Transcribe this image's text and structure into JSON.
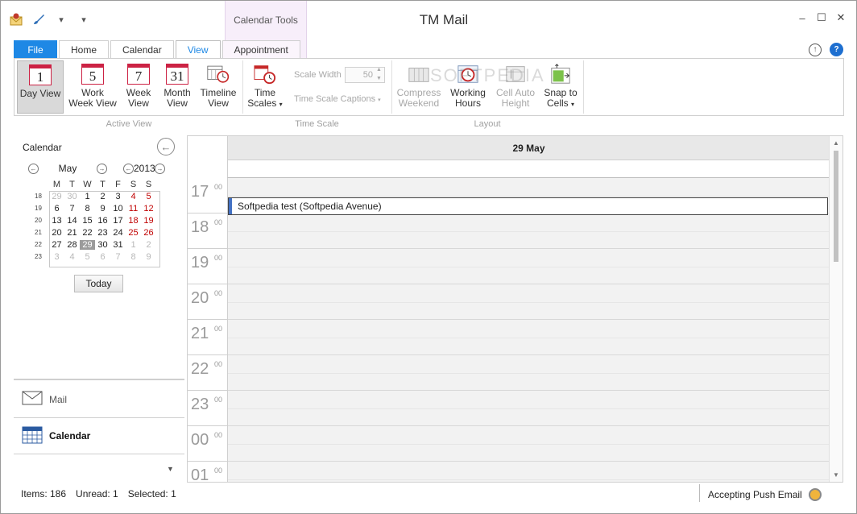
{
  "app": {
    "title": "TM Mail",
    "contextual_group": "Calendar Tools"
  },
  "ribbon": {
    "tabs": [
      {
        "label": "File",
        "state": "file"
      },
      {
        "label": "Home",
        "state": ""
      },
      {
        "label": "Calendar",
        "state": ""
      },
      {
        "label": "View",
        "state": "active"
      },
      {
        "label": "Appointment",
        "state": "contextual"
      }
    ],
    "active_view": {
      "group_label": "Active View",
      "day": {
        "num": "1",
        "label": "Day View"
      },
      "work_week": {
        "num": "5",
        "label1": "Work",
        "label2": "Week View"
      },
      "week": {
        "num": "7",
        "label1": "Week",
        "label2": "View"
      },
      "month": {
        "num": "31",
        "label1": "Month",
        "label2": "View"
      },
      "timeline": {
        "label1": "Timeline",
        "label2": "View"
      }
    },
    "time_scale": {
      "group_label": "Time Scale",
      "time_scales": {
        "label1": "Time",
        "label2": "Scales"
      },
      "scale_width_label": "Scale Width",
      "scale_width_value": "50",
      "captions_label": "Time Scale Captions"
    },
    "layout": {
      "group_label": "Layout",
      "compress": {
        "label1": "Compress",
        "label2": "Weekend"
      },
      "working": {
        "label1": "Working",
        "label2": "Hours"
      },
      "cell_auto": {
        "label1": "Cell Auto",
        "label2": "Height"
      },
      "snap": {
        "label1": "Snap to",
        "label2": "Cells"
      }
    },
    "watermark": "SOFTPEDIA"
  },
  "navigator": {
    "title": "Calendar",
    "month": "May",
    "year": "2013",
    "weekday_headers": [
      "M",
      "T",
      "W",
      "T",
      "F",
      "S",
      "S"
    ],
    "weeks": [
      {
        "num": "18",
        "days": [
          "29",
          "30",
          "1",
          "2",
          "3",
          "4",
          "5"
        ]
      },
      {
        "num": "19",
        "days": [
          "6",
          "7",
          "8",
          "9",
          "10",
          "11",
          "12"
        ]
      },
      {
        "num": "20",
        "days": [
          "13",
          "14",
          "15",
          "16",
          "17",
          "18",
          "19"
        ]
      },
      {
        "num": "21",
        "days": [
          "20",
          "21",
          "22",
          "23",
          "24",
          "25",
          "26"
        ]
      },
      {
        "num": "22",
        "days": [
          "27",
          "28",
          "29",
          "30",
          "31",
          "1",
          "2"
        ]
      },
      {
        "num": "23",
        "days": [
          "3",
          "4",
          "5",
          "6",
          "7",
          "8",
          "9"
        ]
      }
    ],
    "today_button": "Today"
  },
  "nav_pane": {
    "mail": "Mail",
    "calendar": "Calendar"
  },
  "day_view": {
    "date_header": "29 May",
    "hours": [
      {
        "h": "17",
        "m": "00"
      },
      {
        "h": "18",
        "m": "00"
      },
      {
        "h": "19",
        "m": "00"
      },
      {
        "h": "20",
        "m": "00"
      },
      {
        "h": "21",
        "m": "00"
      },
      {
        "h": "22",
        "m": "00"
      },
      {
        "h": "23",
        "m": "00"
      },
      {
        "h": "00",
        "m": "00"
      },
      {
        "h": "01",
        "m": "00"
      }
    ],
    "appointment": "Softpedia test (Softpedia Avenue)"
  },
  "status": {
    "items": "Items: 186",
    "unread": "Unread: 1",
    "selected": "Selected: 1",
    "push": "Accepting Push Email"
  }
}
